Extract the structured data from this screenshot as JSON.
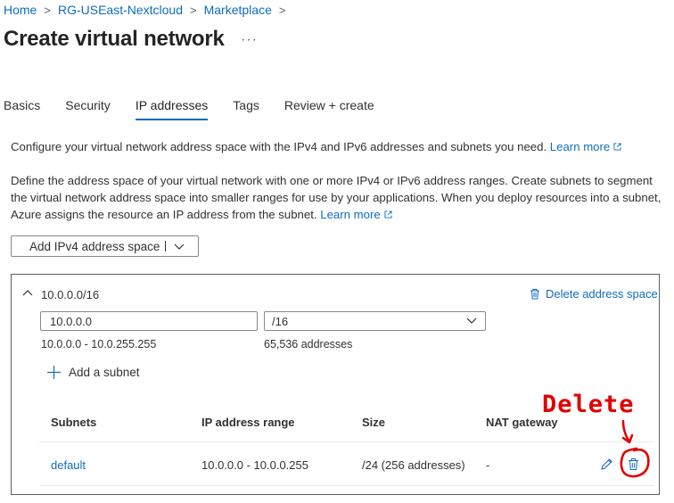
{
  "breadcrumb": [
    "Home",
    "RG-USEast-Nextcloud",
    "Marketplace"
  ],
  "page_title": "Create virtual network",
  "more_label": "···",
  "tabs": [
    "Basics",
    "Security",
    "IP addresses",
    "Tags",
    "Review + create"
  ],
  "active_tab": "IP addresses",
  "intro": {
    "text": "Configure your virtual network address space with the IPv4 and IPv6 addresses and subnets you need.",
    "link": "Learn more"
  },
  "description": {
    "text": "Define the address space of your virtual network with one or more IPv4 or IPv6 address ranges. Create subnets to segment the virtual network address space into smaller ranges for use by your applications. When you deploy resources into a subnet, Azure assigns the resource an IP address from the subnet.",
    "link": "Learn more"
  },
  "add_address_space_button": "Add IPv4 address space",
  "address_space": {
    "title": "10.0.0.0/16",
    "delete_label": "Delete address space",
    "address_value": "10.0.0.0",
    "prefix_value": "/16",
    "range_text": "10.0.0.0 - 10.0.255.255",
    "count_text": "65,536 addresses",
    "add_subnet_label": "Add a subnet"
  },
  "subnets_table": {
    "headers": [
      "Subnets",
      "IP address range",
      "Size",
      "NAT gateway"
    ],
    "rows": [
      {
        "name": "default",
        "range": "10.0.0.0 - 10.0.0.255",
        "size": "/24 (256 addresses)",
        "nat": "-"
      }
    ]
  },
  "annotation": {
    "text": "Delete",
    "color": "#e00000"
  },
  "colors": {
    "accent": "#0f6cbd",
    "text": "#323130",
    "border": "#8a8886"
  }
}
